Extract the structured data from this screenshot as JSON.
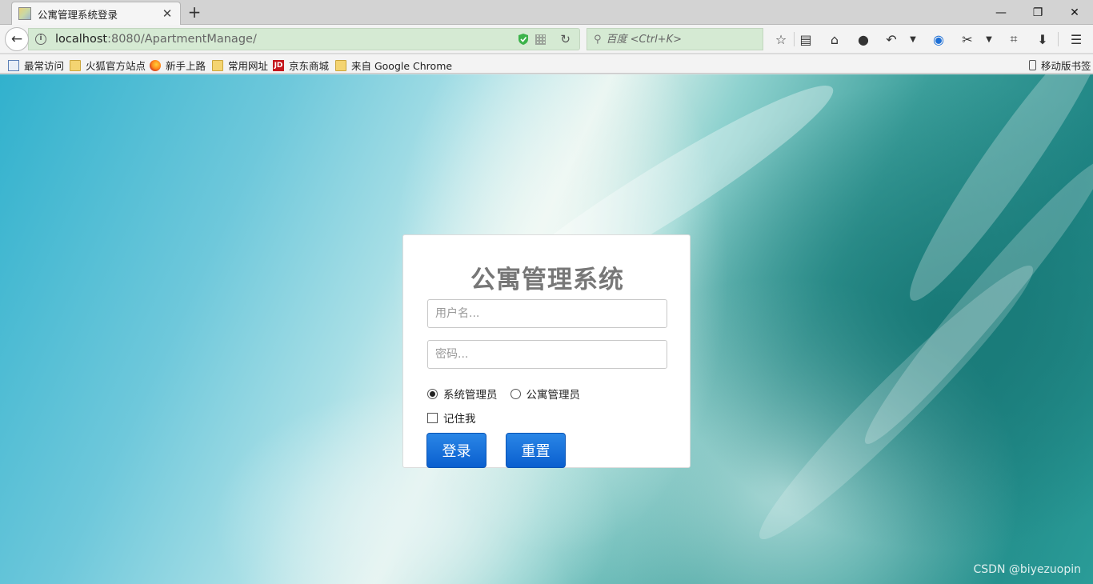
{
  "browser": {
    "tab": {
      "title": "公寓管理系统登录"
    },
    "new_tab_label": "+",
    "window_controls": {
      "minimize": "—",
      "restore": "❐",
      "close": "✕"
    },
    "url": {
      "host": "localhost",
      "rest": ":8080/ApartmentManage/"
    },
    "search": {
      "placeholder": "百度 <Ctrl+K>"
    },
    "bookmarks": [
      {
        "label": "最常访问",
        "icon": "recent-icon"
      },
      {
        "label": "火狐官方站点",
        "icon": "folder-icon"
      },
      {
        "label": "新手上路",
        "icon": "firefox-icon"
      },
      {
        "label": "常用网址",
        "icon": "folder-icon"
      },
      {
        "label": "京东商城",
        "icon": "jd-icon",
        "icon_text": "JD"
      },
      {
        "label": "来自 Google Chrome",
        "icon": "folder-icon"
      }
    ],
    "mobile_bookmarks": "移动版书签"
  },
  "login": {
    "title": "公寓管理系统",
    "username_placeholder": "用户名...",
    "password_placeholder": "密码...",
    "roles": [
      {
        "label": "系统管理员",
        "checked": true
      },
      {
        "label": "公寓管理员",
        "checked": false
      }
    ],
    "remember_label": "记住我",
    "remember_checked": false,
    "login_button": "登录",
    "reset_button": "重置"
  },
  "watermark": "CSDN @biyezuopin",
  "colors": {
    "button": "#0a5fcf",
    "title_gray": "#777777",
    "url_bar": "#d5ead3"
  }
}
